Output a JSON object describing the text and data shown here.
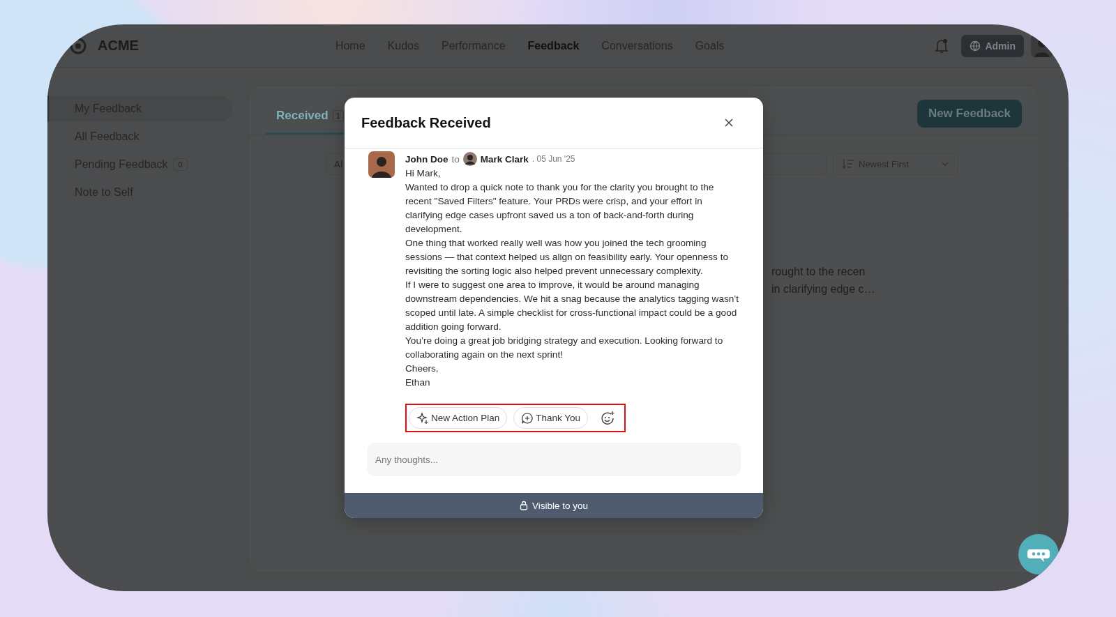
{
  "app": {
    "brand": "ACME",
    "admin_button": "Admin"
  },
  "nav": [
    {
      "label": "Home",
      "selected": false
    },
    {
      "label": "Kudos",
      "selected": false
    },
    {
      "label": "Performance",
      "selected": false
    },
    {
      "label": "Feedback",
      "selected": true
    },
    {
      "label": "Conversations",
      "selected": false
    },
    {
      "label": "Goals",
      "selected": false
    }
  ],
  "sidebar": {
    "items": [
      {
        "label": "My Feedback",
        "selected": true
      },
      {
        "label": "All Feedback",
        "selected": false
      },
      {
        "label": "Pending Feedback",
        "selected": false,
        "badge": "0"
      },
      {
        "label": "Note to Self",
        "selected": false
      }
    ]
  },
  "main": {
    "tabs": [
      {
        "label": "Received",
        "badge": "1",
        "selected": true
      }
    ],
    "new_feedback_button": "New Feedback",
    "filter_field": {
      "value": "Al"
    },
    "sort_dropdown": {
      "value": "Newest First"
    },
    "preview_lines": [
      "rought to the recen",
      "in clarifying edge c…"
    ]
  },
  "modal": {
    "title": "Feedback Received",
    "author": "John Doe",
    "connector": "to",
    "recipient": "Mark Clark",
    "date": ". 05 Jun '25",
    "paragraphs": [
      "Hi Mark,",
      "Wanted to drop a quick note to thank you for the clarity you brought to the recent \"Saved Filters\" feature. Your PRDs were crisp, and your effort in clarifying edge cases upfront saved us a ton of back-and-forth during development.",
      "One thing that worked really well was how you joined the tech grooming sessions — that context helped us align on feasibility early. Your openness to revisiting the sorting logic also helped prevent unnecessary complexity.",
      "If I were to suggest one area to improve, it would be around managing downstream dependencies. We hit a snag because the analytics tagging wasn’t scoped until late. A simple checklist for cross-functional impact could be a good addition going forward.",
      "You’re doing a great job bridging strategy and execution. Looking forward to collaborating again on the next sprint!",
      "Cheers,",
      "Ethan"
    ],
    "actions": [
      {
        "kind": "action-plan",
        "label": "New Action Plan"
      },
      {
        "kind": "thank-you",
        "label": "Thank You"
      },
      {
        "kind": "reaction"
      }
    ],
    "reply": {
      "placeholder": "Any thoughts..."
    },
    "footer": "Visible to you"
  }
}
